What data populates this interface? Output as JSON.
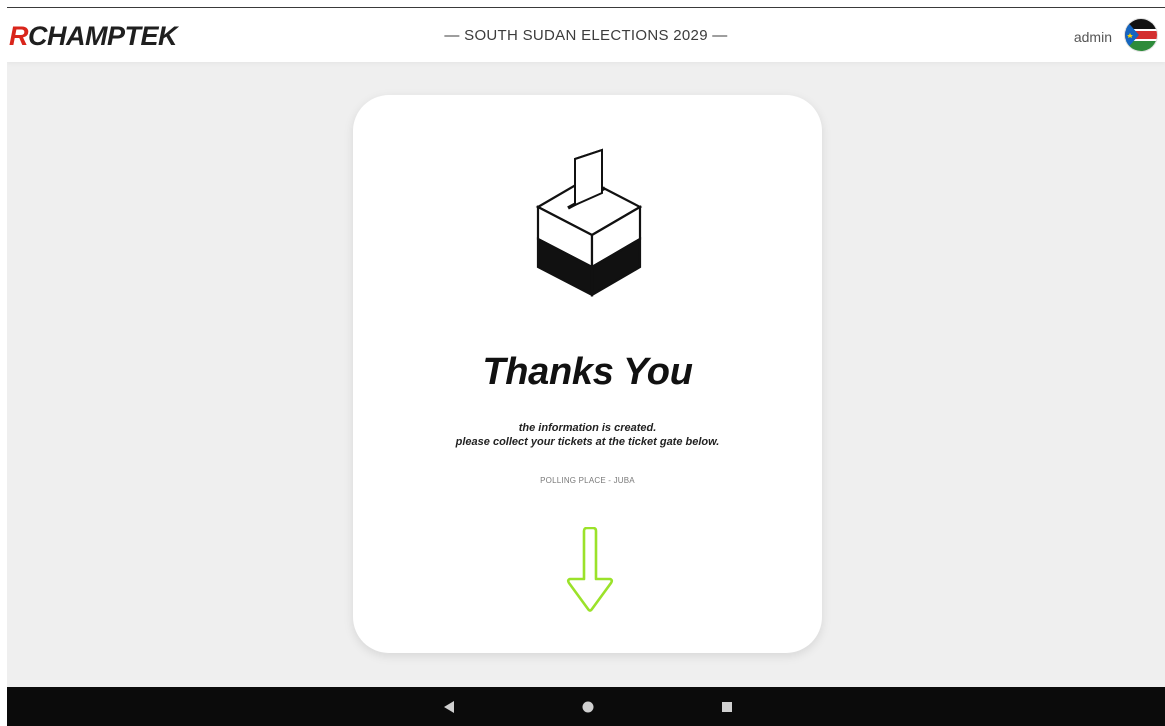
{
  "header": {
    "logo_first": "R",
    "logo_rest": "CHAMPTEK",
    "title": "— SOUTH SUDAN ELECTIONS 2029 —",
    "user": "admin",
    "avatar_icon": "south-sudan-flag-icon"
  },
  "card": {
    "icon": "ballot-box-icon",
    "heading": "Thanks You",
    "message_line1": "the information is created.",
    "message_line2": "please collect your tickets at the ticket gate below.",
    "place": "POLLING PLACE - JUBA",
    "arrow_icon": "arrow-down-icon",
    "arrow_color": "#9be22a"
  },
  "navbar": {
    "back_icon": "back-triangle-icon",
    "home_icon": "home-circle-icon",
    "recents_icon": "recents-square-icon"
  },
  "colors": {
    "logo_accent": "#d9251b",
    "background": "#efefef",
    "card": "#ffffff",
    "navbar": "#0b0b0b"
  }
}
